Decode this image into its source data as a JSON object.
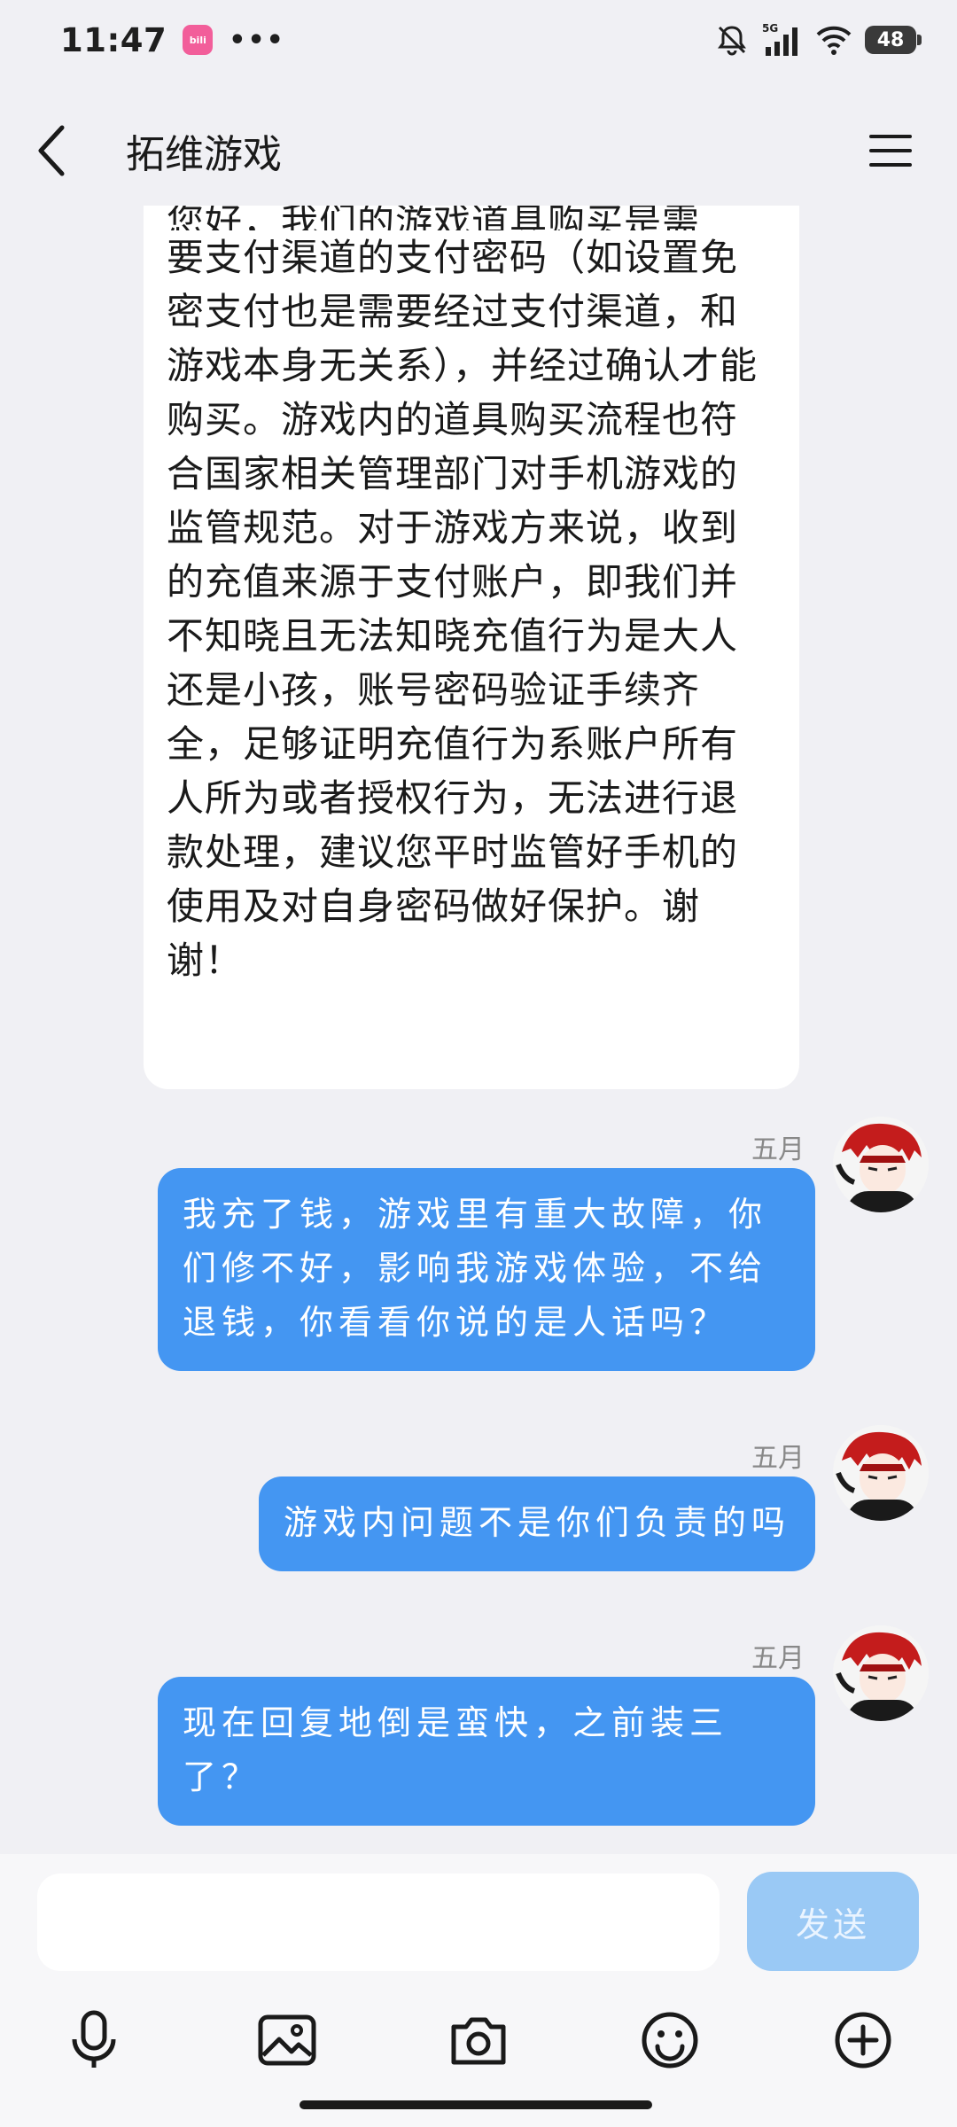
{
  "status_bar": {
    "time": "11:47",
    "app_badge_text": "bilibili",
    "more_dots": "•••",
    "network_label": "5G",
    "battery": "48"
  },
  "header": {
    "title": "拓维游戏",
    "back_icon": "chevron-left-icon",
    "menu_icon": "hamburger-menu-icon"
  },
  "messages": {
    "incoming_partial_line": "您好，我们的游戏道具购买是需",
    "incoming_text": "要支付渠道的支付密码（如设置免密支付也是需要经过支付渠道，和游戏本身无关系），并经过确认才能购买。游戏内的道具购买流程也符合国家相关管理部门对手机游戏的监管规范。对于游戏方来说，收到的充值来源于支付账户，即我们并不知晓且无法知晓充值行为是大人还是小孩，账号密码验证手续齐全，足够证明充值行为系账户所有人所为或者授权行为，无法进行退款处理，建议您平时监管好手机的使用及对自身密码做好保护。谢谢！",
    "outgoing": [
      {
        "time": "五月",
        "text": "我充了钱，游戏里有重大故障，你们修不好，影响我游戏体验，不给退钱，你看看你说的是人话吗？"
      },
      {
        "time": "五月",
        "text": "游戏内问题不是你们负责的吗"
      },
      {
        "time": "五月",
        "text": "现在回复地倒是蛮快，之前装三了？"
      }
    ]
  },
  "input": {
    "placeholder": "",
    "send_label": "发送"
  },
  "toolbar": {
    "icons": [
      "microphone-icon",
      "image-icon",
      "camera-icon",
      "emoji-icon",
      "plus-icon"
    ]
  }
}
